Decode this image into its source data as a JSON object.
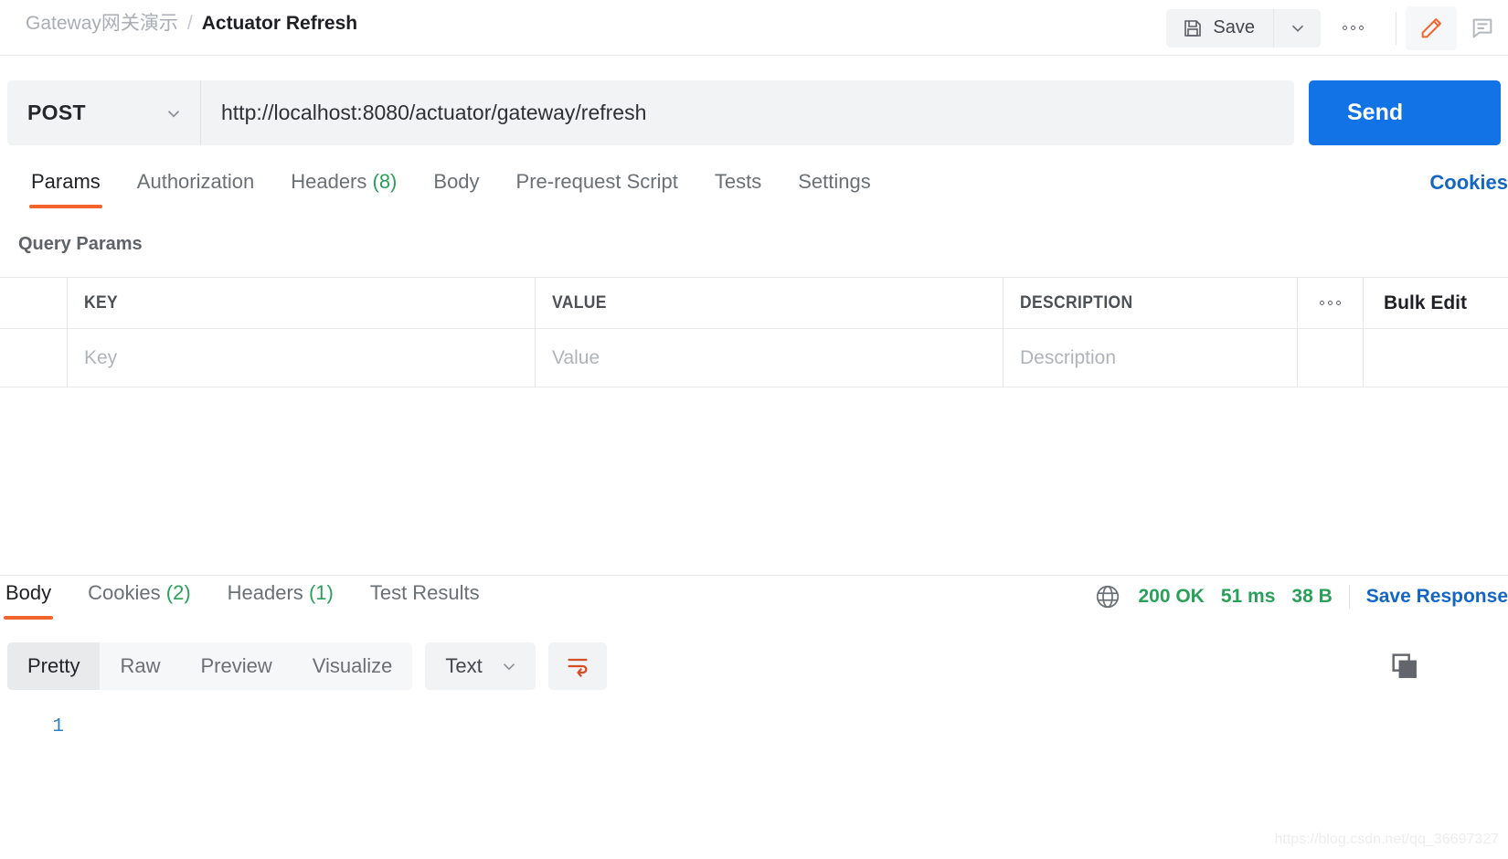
{
  "app": {
    "name": "postman-request-builder"
  },
  "breadcrumb": {
    "collection": "Gateway网关演示",
    "separator": "/",
    "request": "Actuator Refresh"
  },
  "toolbar": {
    "save_label": "Save",
    "save_icon": "floppy-disk-icon",
    "caret_icon": "chevron-down-icon",
    "more_icon": "ellipsis-icon",
    "edit_icon": "pencil-icon",
    "comment_icon": "comment-icon",
    "accent_color": "#f2642b"
  },
  "request": {
    "method": "POST",
    "method_caret_icon": "chevron-down-icon",
    "url": "http://localhost:8080/actuator/gateway/refresh",
    "url_placeholder": "Enter request URL",
    "send_label": "Send"
  },
  "request_tabs": [
    {
      "label": "Params",
      "count": "",
      "active": true
    },
    {
      "label": "Authorization",
      "count": "",
      "active": false
    },
    {
      "label": "Headers",
      "count": "(8)",
      "active": false
    },
    {
      "label": "Body",
      "count": "",
      "active": false
    },
    {
      "label": "Pre-request Script",
      "count": "",
      "active": false
    },
    {
      "label": "Tests",
      "count": "",
      "active": false
    },
    {
      "label": "Settings",
      "count": "",
      "active": false
    }
  ],
  "cookies_link": "Cookies",
  "query_params": {
    "title": "Query Params",
    "columns": [
      "KEY",
      "VALUE",
      "DESCRIPTION"
    ],
    "more_icon": "ellipsis-icon",
    "bulk_edit_label": "Bulk Edit",
    "rows": [
      {
        "key_placeholder": "Key",
        "value_placeholder": "Value",
        "description_placeholder": "Description"
      }
    ]
  },
  "response_tabs": [
    {
      "label": "Body",
      "count": "",
      "active": true
    },
    {
      "label": "Cookies",
      "count": "(2)",
      "active": false
    },
    {
      "label": "Headers",
      "count": "(1)",
      "active": false
    },
    {
      "label": "Test Results",
      "count": "",
      "active": false
    }
  ],
  "response_meta": {
    "network_icon": "globe-icon",
    "status": "200 OK",
    "time": "51 ms",
    "size": "38 B",
    "save_response_label": "Save Response",
    "status_color": "#2aa05a",
    "link_color": "#1466c4"
  },
  "viewer": {
    "modes": [
      {
        "label": "Pretty",
        "active": true
      },
      {
        "label": "Raw",
        "active": false
      },
      {
        "label": "Preview",
        "active": false
      },
      {
        "label": "Visualize",
        "active": false
      }
    ],
    "format": "Text",
    "format_caret_icon": "chevron-down-icon",
    "wrap_icon": "word-wrap-icon",
    "copy_icon": "copy-icon"
  },
  "response_body": {
    "lines": [
      {
        "number": "1",
        "text": ""
      }
    ]
  },
  "watermark": "https://blog.csdn.net/qq_36697327"
}
